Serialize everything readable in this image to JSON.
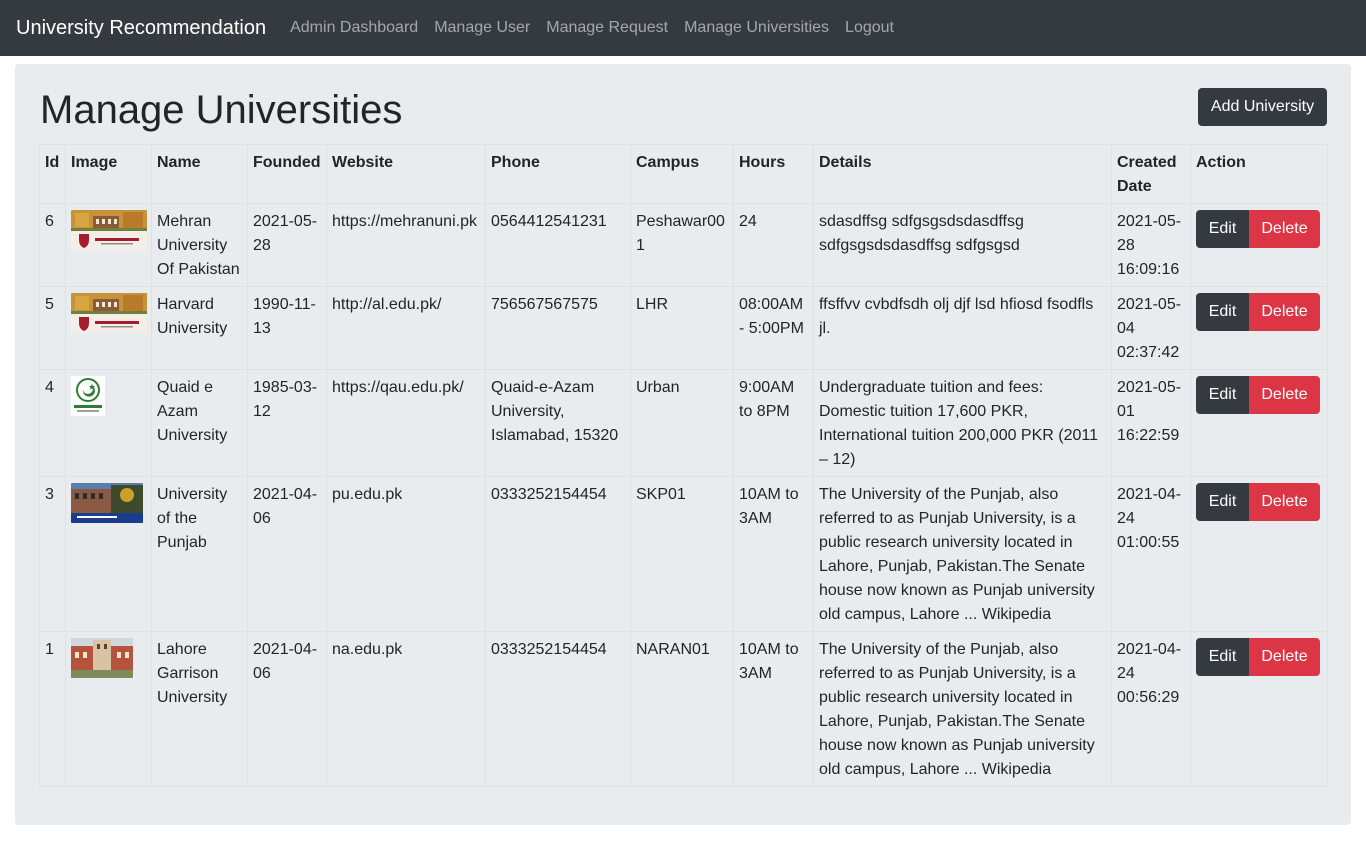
{
  "navbar": {
    "brand": "University Recommendation",
    "links": [
      "Admin Dashboard",
      "Manage User",
      "Manage Request",
      "Manage Universities",
      "Logout"
    ]
  },
  "page": {
    "title": "Manage Universities",
    "add_button": "Add University"
  },
  "table": {
    "headers": [
      "Id",
      "Image",
      "Name",
      "Founded",
      "Website",
      "Phone",
      "Campus",
      "Hours",
      "Details",
      "Created Date",
      "Action"
    ],
    "rows": [
      {
        "id": "6",
        "image": "harvard-building-with-logo",
        "name": "Mehran University Of Pakistan",
        "founded": "2021-05-28",
        "website": "https://mehranuni.pk",
        "phone": "0564412541231",
        "campus": "Peshawar001",
        "hours": "24",
        "details": "sdasdffsg sdfgsgsdsdasdffsg sdfgsgsdsdasdffsg sdfgsgsd",
        "created": "2021-05-28 16:09:16",
        "edit": "Edit",
        "delete": "Delete"
      },
      {
        "id": "5",
        "image": "harvard-building-with-logo",
        "name": "Harvard University",
        "founded": "1990-11-13",
        "website": "http://al.edu.pk/",
        "phone": "756567567575",
        "campus": "LHR",
        "hours": "08:00AM - 5:00PM",
        "details": "ffsffvv cvbdfsdh olj djf lsd hfiosd fsodfls jl.",
        "created": "2021-05-04 02:37:42",
        "edit": "Edit",
        "delete": "Delete"
      },
      {
        "id": "4",
        "image": "quaid-e-azam-emblem",
        "name": "Quaid e Azam University",
        "founded": "1985-03-12",
        "website": "https://qau.edu.pk/",
        "phone": "Quaid-e-Azam University, Islamabad, 15320",
        "campus": "Urban",
        "hours": "9:00AM to 8PM",
        "details": "Undergraduate tuition and fees: Domestic tuition 17,600 PKR, International tuition 200,000 PKR (2011 – 12)",
        "created": "2021-05-01 16:22:59",
        "edit": "Edit",
        "delete": "Delete"
      },
      {
        "id": "3",
        "image": "punjab-university-building",
        "name": "University of the Punjab",
        "founded": "2021-04-06",
        "website": "pu.edu.pk",
        "phone": "0333252154454",
        "campus": "SKP01",
        "hours": "10AM to 3AM",
        "details": "The University of the Punjab, also referred to as Punjab University, is a public research university located in Lahore, Punjab, Pakistan.The Senate house now known as Punjab university old campus, Lahore ... Wikipedia",
        "created": "2021-04-24 01:00:55",
        "edit": "Edit",
        "delete": "Delete"
      },
      {
        "id": "1",
        "image": "lahore-garrison-building",
        "name": "Lahore Garrison University",
        "founded": "2021-04-06",
        "website": "na.edu.pk",
        "phone": "0333252154454",
        "campus": "NARAN01",
        "hours": "10AM to 3AM",
        "details": "The University of the Punjab, also referred to as Punjab University, is a public research university located in Lahore, Punjab, Pakistan.The Senate house now known as Punjab university old campus, Lahore ... Wikipedia",
        "created": "2021-04-24 00:56:29",
        "edit": "Edit",
        "delete": "Delete"
      }
    ]
  },
  "colors": {
    "navbar": "#343a40",
    "panel": "#e9ecef",
    "dark_button": "#343a40",
    "danger_button": "#dc3545"
  }
}
